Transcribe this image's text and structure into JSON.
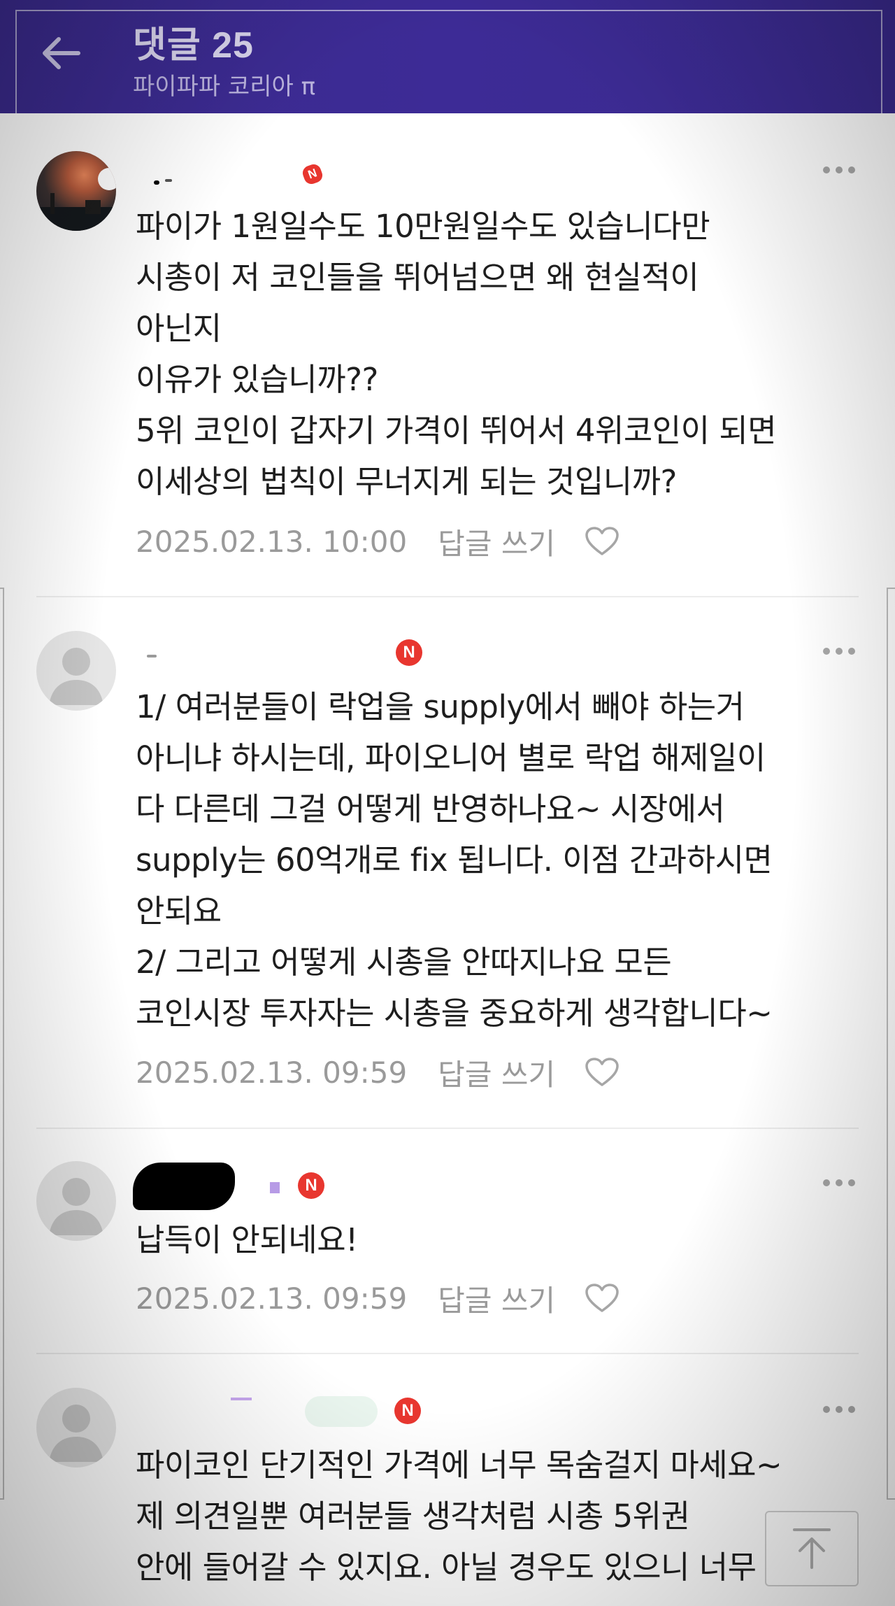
{
  "header": {
    "title": "댓글 25",
    "subtitle": "파이파파 코리아 π"
  },
  "comments": [
    {
      "text": "파이가 1원일수도 10만원일수도 있습니다만\n시총이 저 코인들을 뛰어넘으면 왜 현실적이\n아닌지\n이유가 있습니까??\n5위 코인이 갑자기 가격이 뛰어서 4위코인이 되면\n이세상의 법칙이 무너지게 되는 것입니까?",
      "date": "2025.02.13. 10:00",
      "reply_label": "답글 쓰기",
      "badge": "N"
    },
    {
      "text": "1/ 여러분들이 락업을 supply에서 빼야 하는거\n아니냐 하시는데, 파이오니어 별로 락업 해제일이\n다 다른데 그걸 어떻게 반영하나요~ 시장에서\nsupply는 60억개로 fix 됩니다. 이점 간과하시면\n안되요\n2/ 그리고 어떻게 시총을 안따지나요 모든\n코인시장 투자자는 시총을 중요하게 생각합니다~",
      "date": "2025.02.13. 09:59",
      "reply_label": "답글 쓰기",
      "badge": "N"
    },
    {
      "text": "납득이 안되네요!",
      "date": "2025.02.13. 09:59",
      "reply_label": "답글 쓰기",
      "badge": "N"
    },
    {
      "text": "파이코인 단기적인 가격에 너무 목숨걸지 마세요~\n제 의견일뿐 여러분들 생각처럼 시총 5위권\n안에 들어갈 수 있지요. 아닐 경우도 있으니 너무",
      "badge": "N"
    }
  ],
  "icons": {
    "back": "arrow-left-icon",
    "more": "more-horizontal-icon",
    "like": "heart-outline-icon",
    "scroll_top": "arrow-up-to-top-icon"
  },
  "colors": {
    "header_bg": "#3d2b96",
    "badge": "#e8362f",
    "meta_text": "#9a9a9a",
    "body_text": "#1e1e1e"
  }
}
